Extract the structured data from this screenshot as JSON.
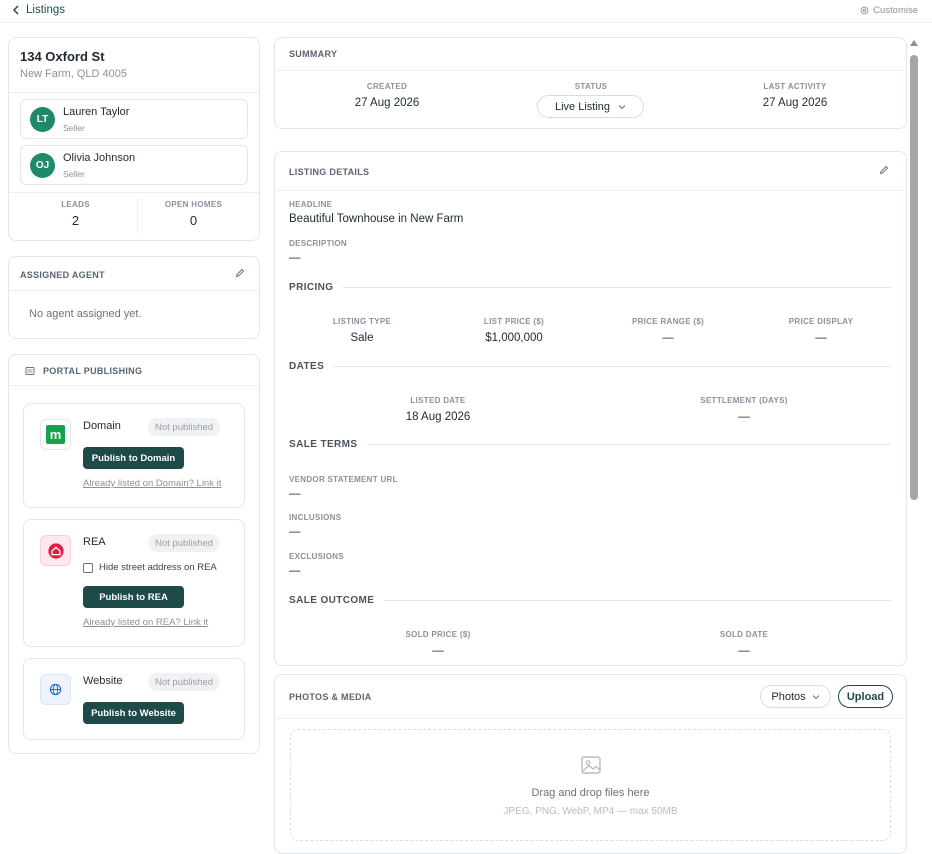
{
  "nav": {
    "back_label": "Listings",
    "customise_label": "Customise"
  },
  "property": {
    "address": "134 Oxford St",
    "suburb": "New Farm, QLD 4005"
  },
  "people": [
    {
      "initials": "LT",
      "name": "Lauren Taylor",
      "role": "Seller"
    },
    {
      "initials": "OJ",
      "name": "Olivia Johnson",
      "role": "Seller"
    }
  ],
  "stats": {
    "leads_label": "LEADS",
    "leads": "2",
    "open_homes_label": "OPEN HOMES",
    "open_homes": "0"
  },
  "agent": {
    "header": "ASSIGNED AGENT",
    "empty": "No agent assigned yet."
  },
  "portals": {
    "header": "PORTAL PUBLISHING",
    "domain": {
      "name": "Domain",
      "status": "Not published",
      "button": "Publish to Domain",
      "link": "Already listed on Domain? Link it",
      "logo": "m"
    },
    "rea": {
      "name": "REA",
      "status": "Not published",
      "checkbox": "Hide street address on REA",
      "button": "Publish to REA",
      "link": "Already listed on REA? Link it"
    },
    "website": {
      "name": "Website",
      "status": "Not published",
      "button": "Publish to Website"
    }
  },
  "summary": {
    "header": "SUMMARY",
    "created_label": "CREATED",
    "created": "27 Aug 2026",
    "status_label": "STATUS",
    "status": "Live Listing",
    "last_activity_label": "LAST ACTIVITY",
    "last_activity": "27 Aug 2026"
  },
  "details": {
    "header": "LISTING DETAILS",
    "headline_label": "HEADLINE",
    "headline": "Beautiful Townhouse in New Farm",
    "description_label": "DESCRIPTION",
    "description": "—",
    "pricing": {
      "header": "PRICING",
      "listing_type_label": "LISTING TYPE",
      "listing_type": "Sale",
      "list_price_label": "LIST PRICE ($)",
      "list_price": "$1,000,000",
      "price_range_label": "PRICE RANGE ($)",
      "price_range": "—",
      "price_display_label": "PRICE DISPLAY",
      "price_display": "—"
    },
    "dates": {
      "header": "DATES",
      "listed_label": "LISTED DATE",
      "listed": "18 Aug 2026",
      "settlement_label": "SETTLEMENT (DAYS)",
      "settlement": "—"
    },
    "sale_terms": {
      "header": "SALE TERMS",
      "vendor_label": "VENDOR STATEMENT URL",
      "vendor": "—",
      "inclusions_label": "INCLUSIONS",
      "inclusions": "—",
      "exclusions_label": "EXCLUSIONS",
      "exclusions": "—"
    },
    "sale_outcome": {
      "header": "SALE OUTCOME",
      "sold_price_label": "SOLD PRICE ($)",
      "sold_price": "—",
      "sold_date_label": "SOLD DATE",
      "sold_date": "—"
    }
  },
  "media": {
    "header": "PHOTOS & MEDIA",
    "filter": "Photos",
    "upload": "Upload",
    "drop_title": "Drag and drop files here",
    "drop_hint": "JPEG, PNG, WebP, MP4 — max 50MB"
  },
  "colors": {
    "accent": "#1f4a4a",
    "avatar": "#1f8a6a",
    "domain": "#16a34a",
    "rea": "#e11d48",
    "website": "#2563eb"
  }
}
